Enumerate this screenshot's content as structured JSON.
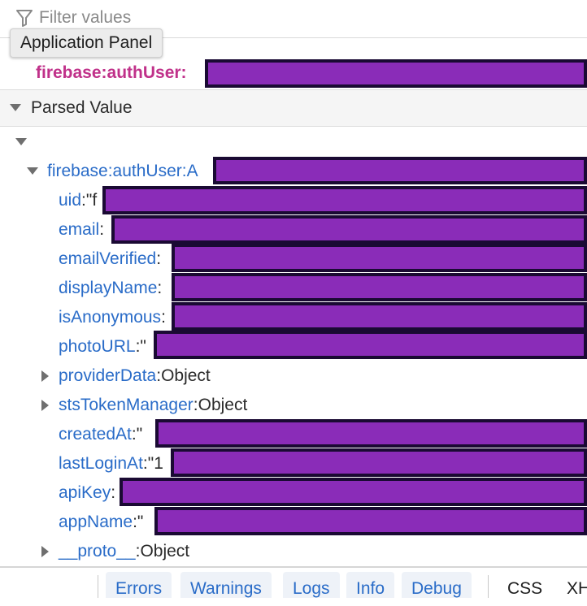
{
  "filter": {
    "placeholder": "Filter values",
    "icon": "filter-icon"
  },
  "tooltip": "Application Panel",
  "key_row": {
    "key": "firebase:authUser:"
  },
  "parsed": {
    "title": "Parsed Value"
  },
  "tree": {
    "root_key": "firebase:authUser:A",
    "props": [
      {
        "key": "uid",
        "sep": ":\"f"
      },
      {
        "key": "email",
        "sep": ":"
      },
      {
        "key": "emailVerified",
        "sep": ":"
      },
      {
        "key": "displayName",
        "sep": ":"
      },
      {
        "key": "isAnonymous",
        "sep": ":"
      },
      {
        "key": "photoURL",
        "sep": ":\""
      },
      {
        "key": "providerData",
        "sep": ":",
        "value": "Object"
      },
      {
        "key": "stsTokenManager",
        "sep": ":",
        "value": "Object"
      },
      {
        "key": "createdAt",
        "sep": ":\""
      },
      {
        "key": "lastLoginAt",
        "sep": ":\"1"
      },
      {
        "key": "apiKey",
        "sep": ":"
      },
      {
        "key": "appName",
        "sep": ":\""
      },
      {
        "key": "__proto__",
        "sep": ":",
        "value": "Object"
      }
    ]
  },
  "bottom": {
    "tabs": [
      "Errors",
      "Warnings",
      "Logs",
      "Info",
      "Debug"
    ],
    "extra": [
      "CSS",
      "XH"
    ]
  },
  "colors": {
    "key_pink": "#c0318a",
    "prop_blue": "#2a6cc8",
    "redaction": "#8a2cb8"
  }
}
